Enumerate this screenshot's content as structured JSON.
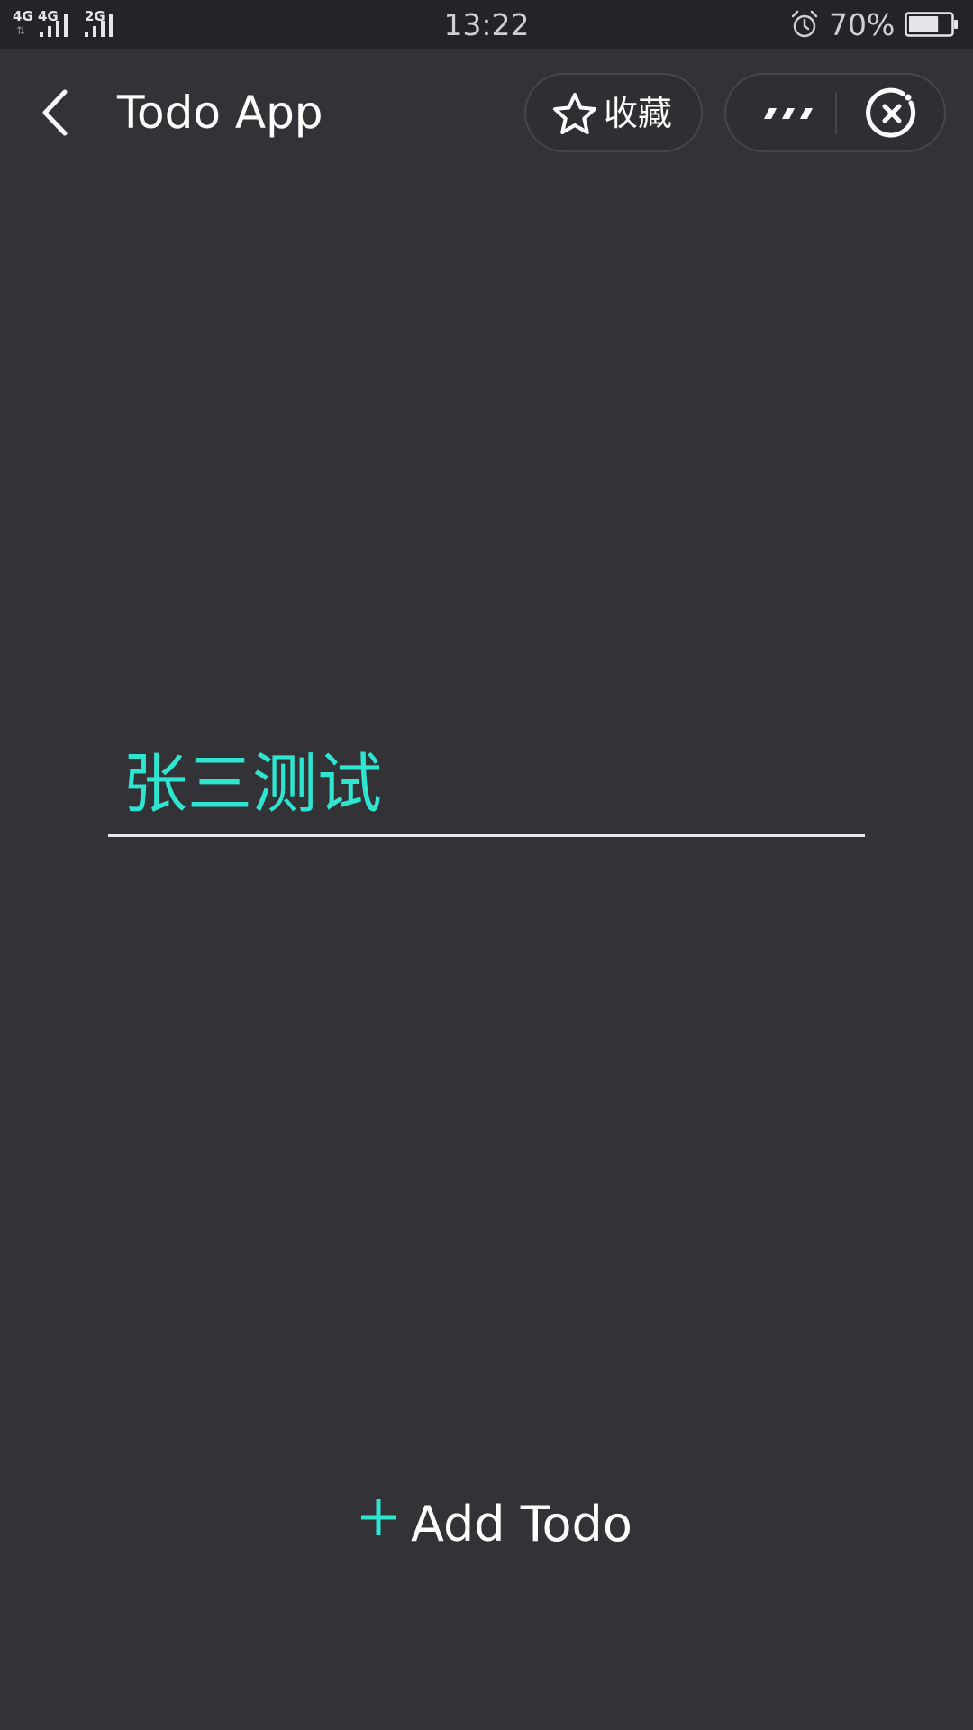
{
  "status_bar": {
    "network_1": "4G",
    "network_2": "4G",
    "network_3": "2G",
    "data_arrows": "⇅",
    "time": "13:22",
    "battery_percent": "70%",
    "battery_level": 0.7
  },
  "nav": {
    "title": "Todo App",
    "favorite_label": "收藏"
  },
  "todo": {
    "input_value": "张三测试"
  },
  "add_button": {
    "label": "Add Todo"
  },
  "colors": {
    "background": "#333237",
    "status_bar": "#242328",
    "accent": "#2ee5d0",
    "text": "#ffffff"
  },
  "icons": {
    "back": "chevron-left-icon",
    "favorite": "star-icon",
    "more": "more-dots-icon",
    "close": "close-circle-icon",
    "alarm": "alarm-clock-icon",
    "battery": "battery-icon",
    "add": "plus-icon"
  }
}
